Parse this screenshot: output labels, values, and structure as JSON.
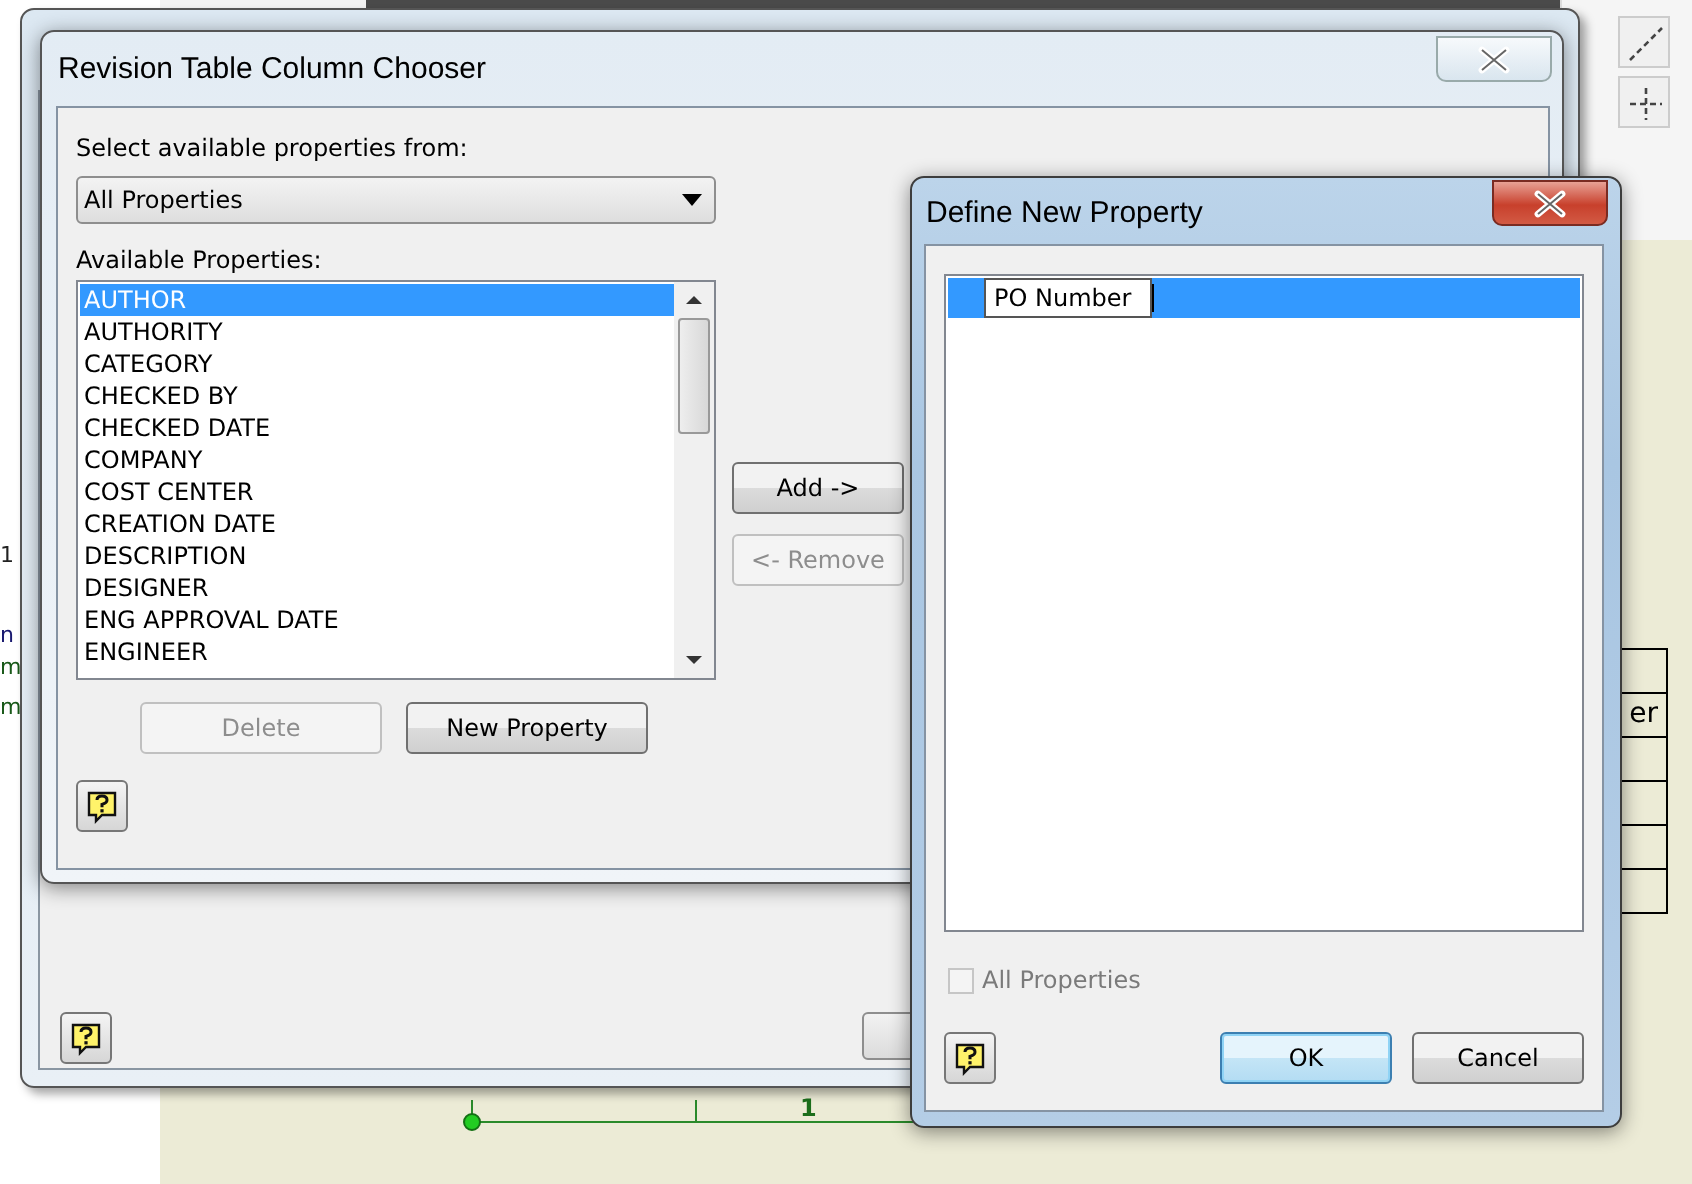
{
  "background_app": {
    "side_labels": [
      "1",
      "n",
      "m",
      "m"
    ],
    "table_cell_text": "er",
    "dimension_label": "1"
  },
  "column_chooser": {
    "title": "Revision Table Column Chooser",
    "source_label": "Select available properties from:",
    "source_value": "All Properties",
    "list_label": "Available Properties:",
    "properties": [
      {
        "label": "AUTHOR",
        "selected": true
      },
      {
        "label": "AUTHORITY",
        "selected": false
      },
      {
        "label": "CATEGORY",
        "selected": false
      },
      {
        "label": "CHECKED BY",
        "selected": false
      },
      {
        "label": "CHECKED DATE",
        "selected": false
      },
      {
        "label": "COMPANY",
        "selected": false
      },
      {
        "label": "COST CENTER",
        "selected": false
      },
      {
        "label": "CREATION DATE",
        "selected": false
      },
      {
        "label": "DESCRIPTION",
        "selected": false
      },
      {
        "label": "DESIGNER",
        "selected": false
      },
      {
        "label": "ENG APPROVAL DATE",
        "selected": false
      },
      {
        "label": "ENGINEER",
        "selected": false
      }
    ],
    "move_buttons": [
      {
        "label": "Add ->",
        "disabled": false
      },
      {
        "label": "<- Remove",
        "disabled": true
      }
    ],
    "list_buttons": [
      {
        "label": "Delete",
        "disabled": true
      },
      {
        "label": "New Property",
        "disabled": false
      }
    ]
  },
  "define_new_property": {
    "title": "Define New Property",
    "rows": [
      {
        "value": "PO Number",
        "selected": true
      }
    ],
    "all_properties": {
      "label": "All Properties",
      "checked": false,
      "disabled": true
    },
    "buttons": [
      {
        "label": "OK",
        "default": true
      },
      {
        "label": "Cancel",
        "default": false
      }
    ]
  }
}
